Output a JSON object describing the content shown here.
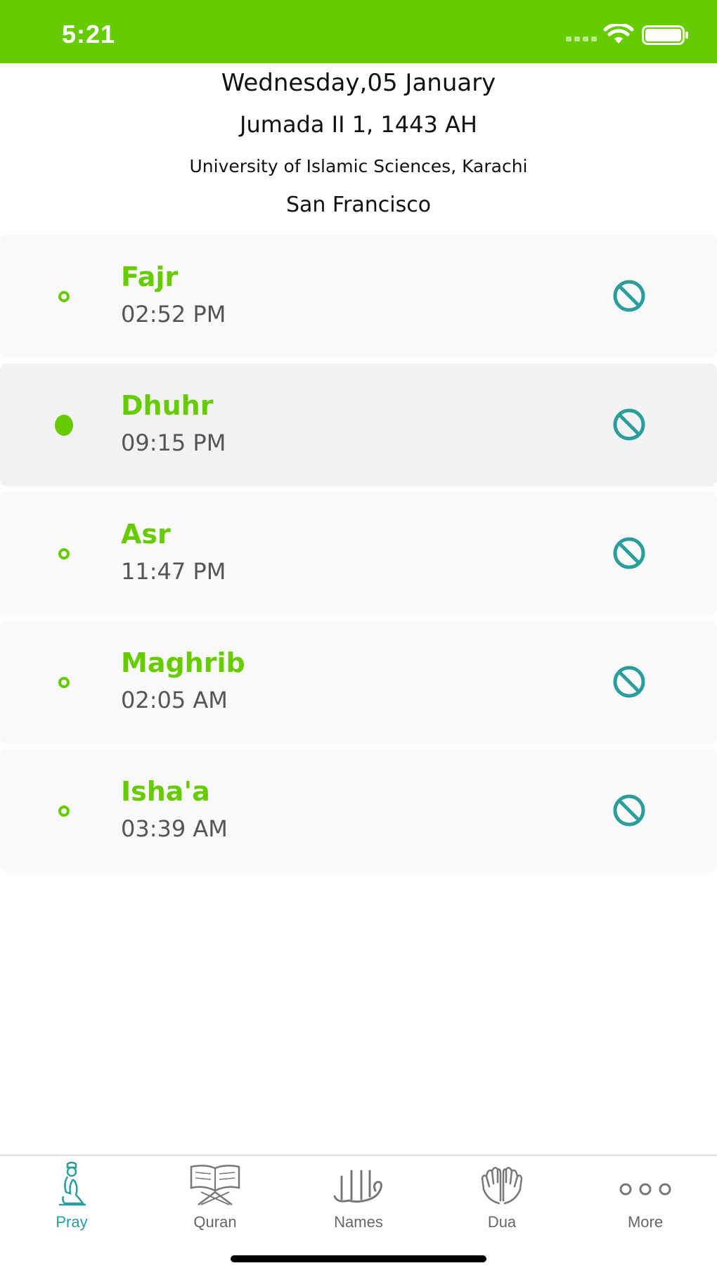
{
  "status_bar": {
    "time": "5:21",
    "background_color": "#66cc00"
  },
  "header": {
    "gregorian_date": "Wednesday,05 January",
    "hijri_date": "Jumada II 1, 1443 AH",
    "calculation_method": "University of Islamic Sciences, Karachi",
    "city": "San Francisco"
  },
  "prayers": [
    {
      "name": "Fajr",
      "time": "02:52 PM",
      "current": false,
      "notification_icon": "mute-icon"
    },
    {
      "name": "Dhuhr",
      "time": "09:15 PM",
      "current": true,
      "notification_icon": "mute-icon"
    },
    {
      "name": "Asr",
      "time": "11:47 PM",
      "current": false,
      "notification_icon": "mute-icon"
    },
    {
      "name": "Maghrib",
      "time": "02:05 AM",
      "current": false,
      "notification_icon": "mute-icon"
    },
    {
      "name": "Isha'a",
      "time": "03:39 AM",
      "current": false,
      "notification_icon": "mute-icon"
    }
  ],
  "tab_bar": {
    "items": [
      {
        "label": "Pray",
        "icon": "praying-person-icon",
        "active": true
      },
      {
        "label": "Quran",
        "icon": "quran-book-icon",
        "active": false
      },
      {
        "label": "Names",
        "icon": "allah-calligraphy-icon",
        "active": false
      },
      {
        "label": "Dua",
        "icon": "praying-hands-icon",
        "active": false
      },
      {
        "label": "More",
        "icon": "more-dots-icon",
        "active": false
      }
    ]
  },
  "colors": {
    "accent_green": "#66cc00",
    "mute_icon_teal": "#2a9d9d",
    "active_tab_teal": "#2a9d9d"
  }
}
